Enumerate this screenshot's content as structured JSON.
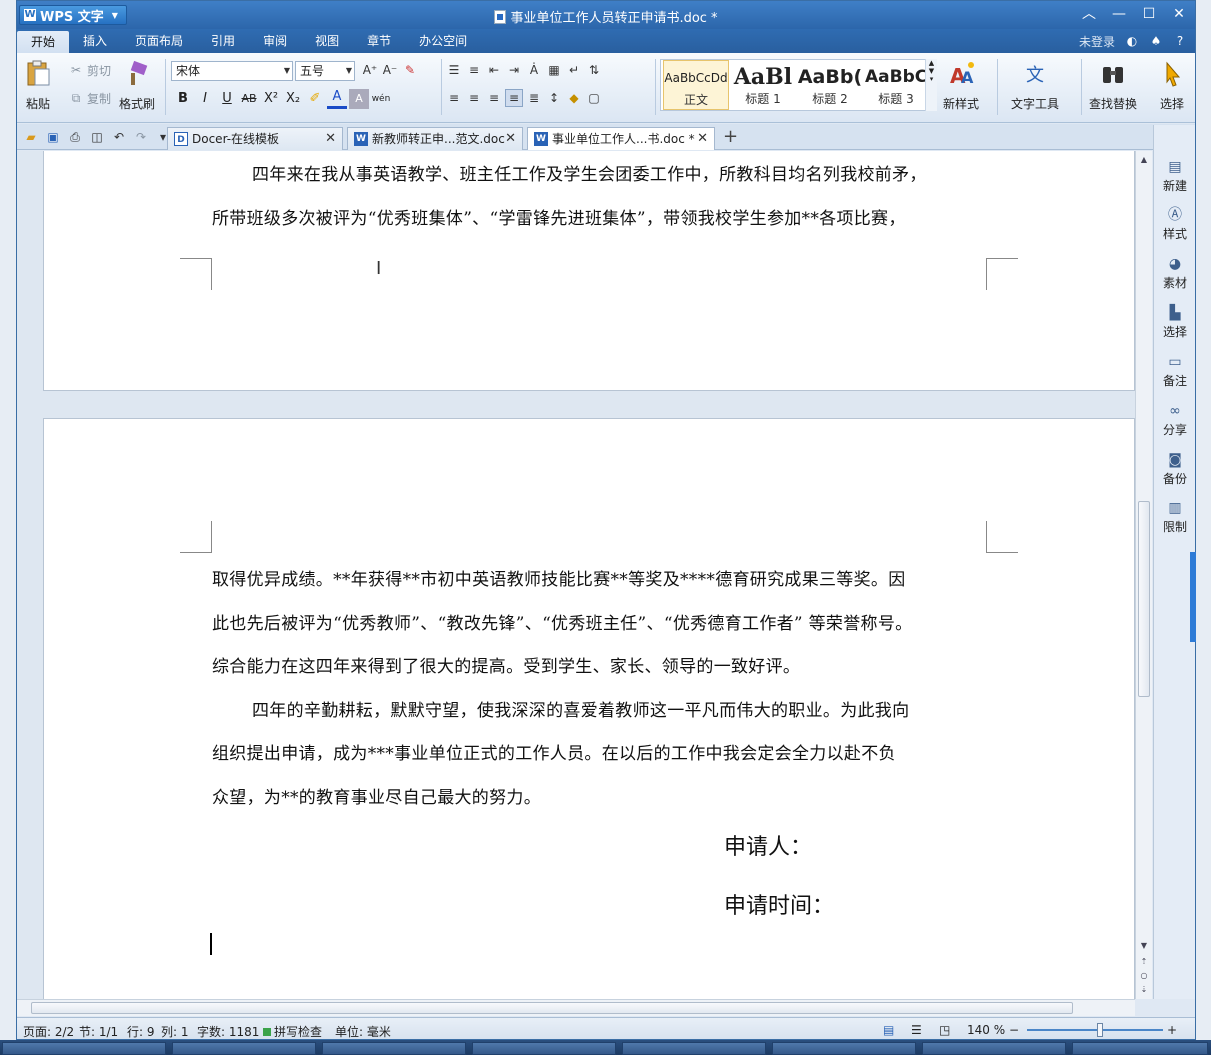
{
  "app": {
    "name": "WPS 文字",
    "window_title": "事业单位工作人员转正申请书.doc *"
  },
  "menu": {
    "tabs": [
      "开始",
      "插入",
      "页面布局",
      "引用",
      "审阅",
      "视图",
      "章节",
      "办公空间"
    ],
    "login": "未登录"
  },
  "ribbon": {
    "paste": "粘贴",
    "cut": "剪切",
    "copy": "复制",
    "format_painter": "格式刷",
    "font_name": "宋体",
    "font_size": "五号",
    "styles": [
      {
        "preview": "AaBbCcDd",
        "name": "正文"
      },
      {
        "preview": "AaBl",
        "name": "标题 1"
      },
      {
        "preview": "AaBb(",
        "name": "标题 2"
      },
      {
        "preview": "AaBbC",
        "name": "标题 3"
      }
    ],
    "new_style": "新样式",
    "text_tools": "文字工具",
    "find_replace": "查找替换",
    "select": "选择"
  },
  "doc_tabs": [
    {
      "label": "Docer-在线模板",
      "icon": "D"
    },
    {
      "label": "新教师转正申...范文.doc",
      "icon": "W"
    },
    {
      "label": "事业单位工作人...书.doc *",
      "icon": "W"
    }
  ],
  "document": {
    "page1_lines": [
      "四年来在我从事英语教学、班主任工作及学生会团委工作中，所教科目均名列我校前矛，",
      "所带班级多次被评为“优秀班集体”、“学雷锋先进班集体”，带领我校学生参加**各项比赛，"
    ],
    "page2_lines": [
      "取得优异成绩。**年获得**市初中英语教师技能比赛**等奖及****德育研究成果三等奖。因",
      "此也先后被评为“优秀教师”、“教改先锋”、“优秀班主任”、“优秀德育工作者” 等荣誉称号。",
      "综合能力在这四年来得到了很大的提高。受到学生、家长、领导的一致好评。",
      "四年的辛勤耕耘，默默守望，使我深深的喜爱着教师这一平凡而伟大的职业。为此我向",
      "组织提出申请，成为***事业单位正式的工作人员。在以后的工作中我会定会全力以赴不负",
      "众望，为**的教育事业尽自己最大的努力。"
    ],
    "applicant": "申请人：",
    "apply_date": "申请时间："
  },
  "task_pane": [
    "新建",
    "样式",
    "素材",
    "选择",
    "备注",
    "分享",
    "备份",
    "限制"
  ],
  "status": {
    "page": "页面: 2/2",
    "section": "节: 1/1",
    "row": "行: 9",
    "col": "列: 1",
    "word_count": "字数: 1181",
    "spell_check": "拼写检查",
    "unit": "单位: 毫米",
    "zoom": "140 %"
  },
  "colors": {
    "title_bar": "#2c66ab",
    "ribbon_bg": "#dbe6f3",
    "accent": "#2e7bd6"
  }
}
